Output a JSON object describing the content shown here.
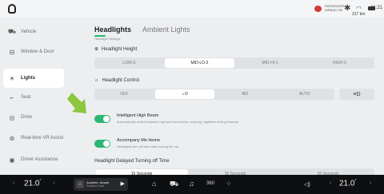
{
  "status": {
    "airbag_line1": "PASSENGER",
    "airbag_line2": "AIRBAG ON",
    "range": "317 km",
    "time": "11:21"
  },
  "sidebar": {
    "items": [
      {
        "label": "Vehicle",
        "icon": "car-icon",
        "glyph": "⛟"
      },
      {
        "label": "Window & Door",
        "icon": "window-icon",
        "glyph": "⊟"
      },
      {
        "label": "Lights",
        "icon": "lights-icon",
        "glyph": "☀"
      },
      {
        "label": "Seat",
        "icon": "seat-icon",
        "glyph": "⌐"
      },
      {
        "label": "Drive",
        "icon": "steering-wheel-icon",
        "glyph": "◎"
      },
      {
        "label": "Real-time VR Assist",
        "icon": "vr-icon",
        "glyph": "⊛"
      },
      {
        "label": "Driver Assistance",
        "icon": "driver-assist-icon",
        "glyph": "◉"
      }
    ],
    "active_index": 2
  },
  "main": {
    "tabs": [
      "Headlights",
      "Ambient Lights"
    ],
    "subtitle": "Headlight Settings",
    "height": {
      "label": "Headlight Height",
      "options": [
        "LOW-S",
        "MID-LO-2",
        "MID-HI-1",
        "HIGH-0"
      ],
      "selected": 1
    },
    "control": {
      "label": "Headlight Control",
      "options": [
        "OFF",
        "☼D",
        "≣D",
        "AUTO"
      ],
      "selected": 1,
      "extra": "≡D"
    },
    "ihb": {
      "title": "Intelligent High Beam",
      "desc": "Automatically switch between high and low beams, reducing nighttime driving hazards"
    },
    "amh": {
      "title": "Accompany Me Home",
      "desc": "Headlights turn off later after locking the car"
    },
    "delay": {
      "label": "Headlight Delayed Turning off Time",
      "options": [
        "15 Seconds",
        "30 Seconds",
        "60 Seconds"
      ],
      "selected": 0
    }
  },
  "dock": {
    "temp_left": "21.0",
    "temp_right": "21.0",
    "degree": "°",
    "media_title": "Anytime, Anywh",
    "media_artist": "Sarahed Kaze",
    "play": "▶",
    "vol": "◁)",
    "ac_label": "360"
  },
  "colors": {
    "accent": "#2bb673",
    "arrow": "#8dc63f"
  }
}
